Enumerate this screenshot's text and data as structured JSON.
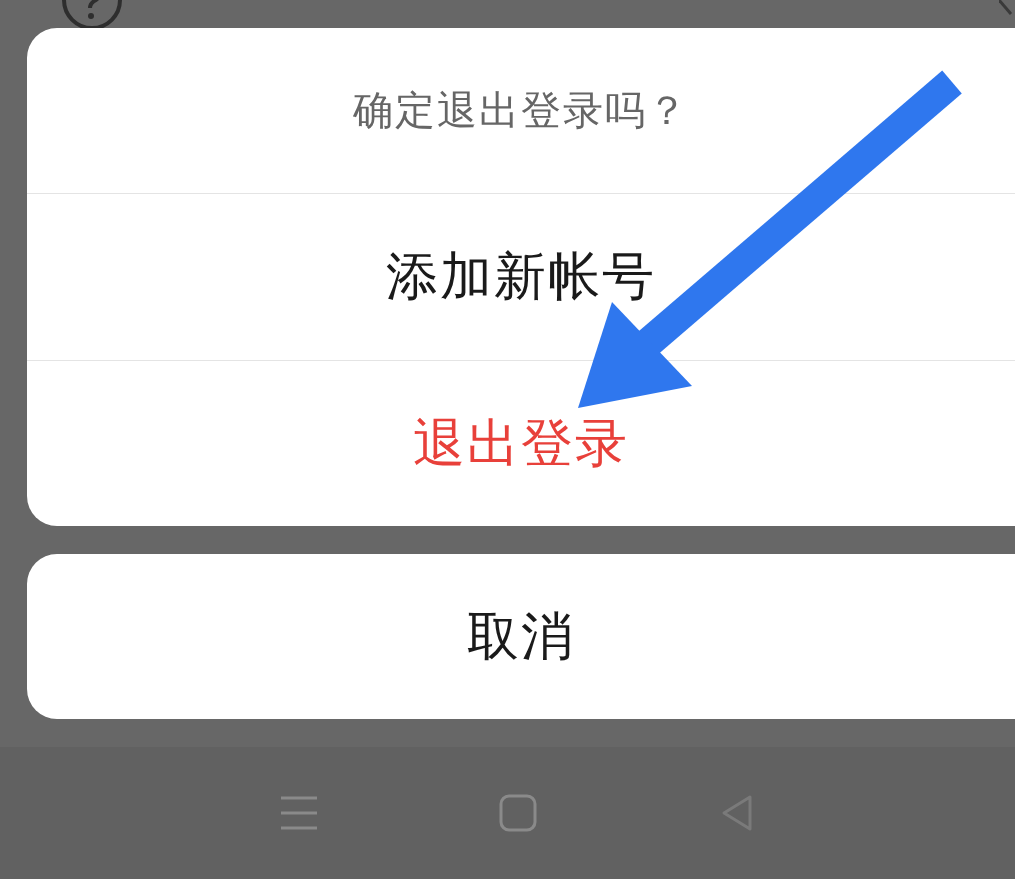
{
  "dialog": {
    "title": "确定退出登录吗？",
    "options": [
      {
        "label": "添加新帐号",
        "kind": "normal"
      },
      {
        "label": "退出登录",
        "kind": "destructive"
      }
    ]
  },
  "cancel_button": {
    "label": "取消"
  }
}
